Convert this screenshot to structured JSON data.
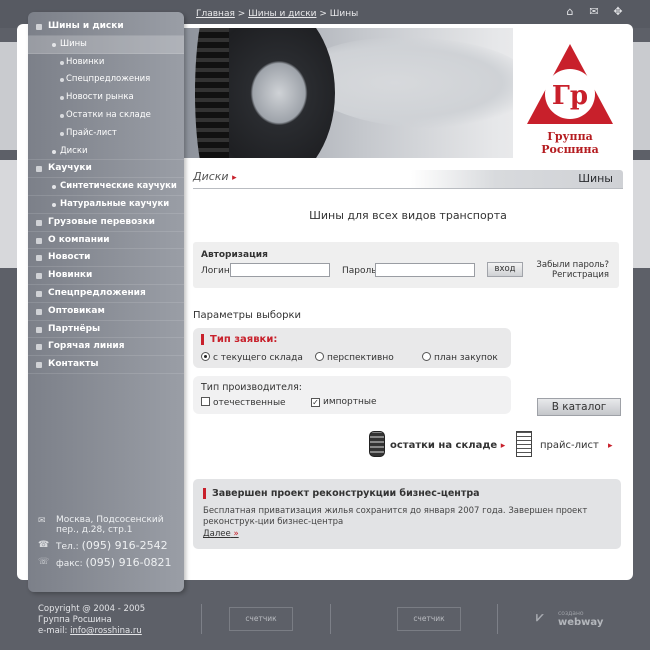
{
  "breadcrumb": {
    "home": "Главная",
    "sep1": " > ",
    "tires_discs": "Шины и диски",
    "sep2": " > ",
    "current": "Шины"
  },
  "top_icons": [
    "home-icon",
    "mail-icon",
    "sitemap-icon"
  ],
  "logo": {
    "letters": "Гр",
    "name": "Группа Росшина"
  },
  "menu": [
    {
      "label": "Шины и диски",
      "level": 0
    },
    {
      "label": "Шины",
      "level": 1,
      "active": true
    },
    {
      "label": "Новинки",
      "level": 2
    },
    {
      "label": "Спецпредложения",
      "level": 2
    },
    {
      "label": "Новости рынка",
      "level": 2
    },
    {
      "label": "Остатки на складе",
      "level": 2
    },
    {
      "label": "Прайс-лист",
      "level": 2
    },
    {
      "label": "Диски",
      "level": 1
    },
    {
      "label": "Каучуки",
      "level": 0
    },
    {
      "label": "Синтетические каучуки",
      "level": 1
    },
    {
      "label": "Натуральные каучуки",
      "level": 1
    },
    {
      "label": "Грузовые перевозки",
      "level": 0
    },
    {
      "label": "О компании",
      "level": 0
    },
    {
      "label": "Новости",
      "level": 0
    },
    {
      "label": "Новинки",
      "level": 0
    },
    {
      "label": "Спецпредложения",
      "level": 0
    },
    {
      "label": "Оптовикам",
      "level": 0
    },
    {
      "label": "Партнёры",
      "level": 0
    },
    {
      "label": "Горячая линия",
      "level": 0
    },
    {
      "label": "Контакты",
      "level": 0
    }
  ],
  "contacts": {
    "address": "Москва, Подсосенский пер., д.28, стр.1",
    "tel_label": "Тел.:",
    "tel": "(095) 916-2542",
    "fax_label": "факс:",
    "fax": "(095) 916-0821"
  },
  "tabs": {
    "left": "Диски",
    "right": "Шины"
  },
  "page_title": "Шины для всех видов транспорта",
  "auth": {
    "title": "Авторизация",
    "login_label": "Логин",
    "password_label": "Пароль",
    "login_value": "",
    "password_value": "",
    "submit": "вход",
    "forgot": "Забыли пароль?",
    "register": "Регистрация"
  },
  "params": {
    "title": "Параметры выборки",
    "order_type": {
      "title": "Тип заявки:",
      "options": [
        "с текущего склада",
        "перспективно",
        "план закупок"
      ],
      "selected": 0
    },
    "producer_type": {
      "title": "Тип производителя:",
      "options": [
        "отечественные",
        "импортные"
      ],
      "checked": [
        false,
        true
      ]
    },
    "catalog_button": "В каталог"
  },
  "links": {
    "stock": "остатки на складе",
    "price": "прайс-лист"
  },
  "news": {
    "title": "Завершен проект реконструкции бизнес-центра",
    "text": "Бесплатная приватизация жилья сохранится до января 2007 года. Завершен проект реконструк-ции бизнес-центра",
    "more": "Далее"
  },
  "footer": {
    "copyright": "Copyright @ 2004 - 2005",
    "company": "Группа Росшина",
    "email_label": "e-mail:",
    "email": "info@rosshina.ru",
    "counter1": "счетчик",
    "counter2": "счетчик",
    "made_by_small": "создано",
    "made_by": "webway"
  }
}
